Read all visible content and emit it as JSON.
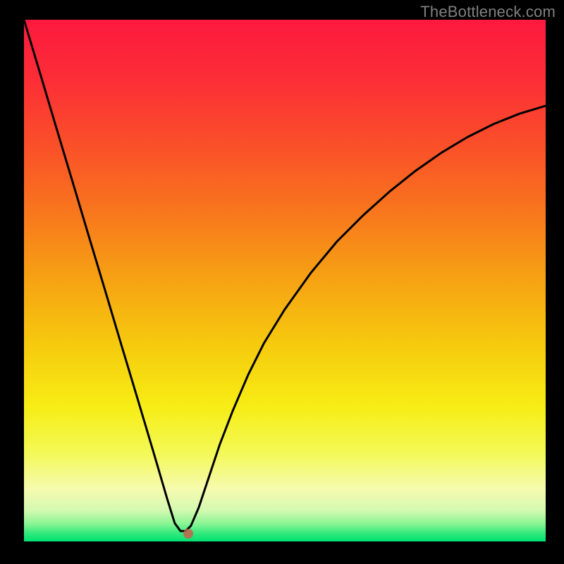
{
  "watermark": "TheBottleneck.com",
  "colors": {
    "background": "#000000",
    "dot": "#c7624c",
    "curve": "#000000",
    "gradient_stops": [
      {
        "offset": 0.0,
        "color": "#fd193e"
      },
      {
        "offset": 0.12,
        "color": "#fc2f36"
      },
      {
        "offset": 0.25,
        "color": "#fa5228"
      },
      {
        "offset": 0.38,
        "color": "#f87a1c"
      },
      {
        "offset": 0.5,
        "color": "#f6a313"
      },
      {
        "offset": 0.62,
        "color": "#f6c90e"
      },
      {
        "offset": 0.74,
        "color": "#f7ed14"
      },
      {
        "offset": 0.83,
        "color": "#f3f956"
      },
      {
        "offset": 0.9,
        "color": "#f6fbb0"
      },
      {
        "offset": 0.94,
        "color": "#d4f9b1"
      },
      {
        "offset": 0.965,
        "color": "#8ef595"
      },
      {
        "offset": 0.985,
        "color": "#30e97b"
      },
      {
        "offset": 1.0,
        "color": "#00e172"
      }
    ]
  },
  "chart_data": {
    "type": "line",
    "title": "",
    "xlabel": "",
    "ylabel": "",
    "xlim": [
      0,
      100
    ],
    "ylim": [
      0,
      100
    ],
    "grid": false,
    "legend": false,
    "marker": {
      "x": 31.5,
      "y": 1.5,
      "color": "#c7624c"
    },
    "series": [
      {
        "name": "curve",
        "x": [
          0.0,
          3.1,
          6.2,
          9.3,
          12.4,
          15.5,
          18.6,
          21.7,
          24.8,
          27.5,
          28.9,
          30.0,
          31.0,
          32.0,
          33.5,
          35.0,
          37.5,
          40.0,
          43.0,
          46.0,
          50.0,
          55.0,
          60.0,
          65.0,
          70.0,
          75.0,
          80.0,
          85.0,
          90.0,
          95.0,
          100.0
        ],
        "y": [
          100.0,
          89.7,
          79.3,
          69.0,
          58.6,
          48.3,
          37.9,
          27.6,
          17.2,
          8.0,
          3.5,
          2.0,
          2.0,
          3.0,
          6.5,
          11.0,
          18.5,
          25.0,
          32.0,
          38.0,
          44.5,
          51.5,
          57.5,
          62.5,
          67.0,
          71.0,
          74.5,
          77.5,
          80.0,
          82.0,
          83.5
        ]
      }
    ]
  }
}
